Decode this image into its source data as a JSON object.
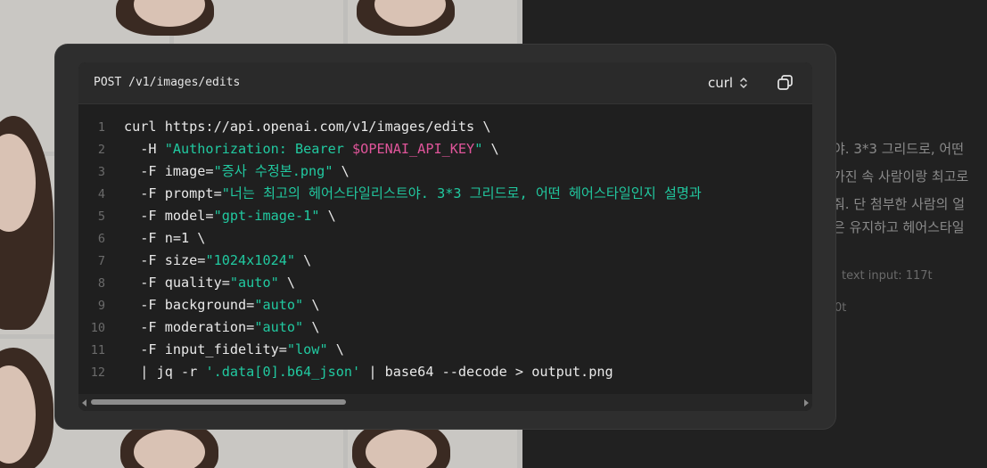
{
  "modal": {
    "endpoint": "POST /v1/images/edits",
    "language": "curl",
    "copy_icon": "copy-icon",
    "chevron_icon": "chevron-up-down-icon"
  },
  "code_lines": [
    {
      "num": "1",
      "parts": [
        {
          "t": "curl https://api.openai.com/v1/images/edits \\",
          "c": ""
        }
      ]
    },
    {
      "num": "2",
      "parts": [
        {
          "t": "  -H ",
          "c": ""
        },
        {
          "t": "\"Authorization: Bearer ",
          "c": "str"
        },
        {
          "t": "$OPENAI_API_KEY",
          "c": "var"
        },
        {
          "t": "\"",
          "c": "str"
        },
        {
          "t": " \\",
          "c": ""
        }
      ]
    },
    {
      "num": "3",
      "parts": [
        {
          "t": "  -F image=",
          "c": ""
        },
        {
          "t": "\"증사 수정본.png\"",
          "c": "str"
        },
        {
          "t": " \\",
          "c": ""
        }
      ]
    },
    {
      "num": "4",
      "parts": [
        {
          "t": "  -F prompt=",
          "c": ""
        },
        {
          "t": "\"너는 최고의 헤어스타일리스트야. 3*3 그리드로, 어떤 헤어스타일인지 설명과",
          "c": "str"
        }
      ]
    },
    {
      "num": "5",
      "parts": [
        {
          "t": "  -F model=",
          "c": ""
        },
        {
          "t": "\"gpt-image-1\"",
          "c": "str"
        },
        {
          "t": " \\",
          "c": ""
        }
      ]
    },
    {
      "num": "6",
      "parts": [
        {
          "t": "  -F n=1 \\",
          "c": ""
        }
      ]
    },
    {
      "num": "7",
      "parts": [
        {
          "t": "  -F size=",
          "c": ""
        },
        {
          "t": "\"1024x1024\"",
          "c": "str"
        },
        {
          "t": " \\",
          "c": ""
        }
      ]
    },
    {
      "num": "8",
      "parts": [
        {
          "t": "  -F quality=",
          "c": ""
        },
        {
          "t": "\"auto\"",
          "c": "str"
        },
        {
          "t": " \\",
          "c": ""
        }
      ]
    },
    {
      "num": "9",
      "parts": [
        {
          "t": "  -F background=",
          "c": ""
        },
        {
          "t": "\"auto\"",
          "c": "str"
        },
        {
          "t": " \\",
          "c": ""
        }
      ]
    },
    {
      "num": "10",
      "parts": [
        {
          "t": "  -F moderation=",
          "c": ""
        },
        {
          "t": "\"auto\"",
          "c": "str"
        },
        {
          "t": " \\",
          "c": ""
        }
      ]
    },
    {
      "num": "11",
      "parts": [
        {
          "t": "  -F input_fidelity=",
          "c": ""
        },
        {
          "t": "\"low\"",
          "c": "str"
        },
        {
          "t": " \\",
          "c": ""
        }
      ]
    },
    {
      "num": "12",
      "parts": [
        {
          "t": "  | jq -r ",
          "c": ""
        },
        {
          "t": "'.data[0].b64_json'",
          "c": "str"
        },
        {
          "t": " | base64 --decode > output.png",
          "c": ""
        }
      ]
    }
  ],
  "background": {
    "text_lines": [
      "야. 3*3 그리드로, 어떤",
      "가진 속 사람이랑 최고로",
      "줘. 단 첨부한 사람의 얼",
      "은 유지하고 헤어스타일"
    ],
    "meta_1": "text input: 117t",
    "meta_2": "0t"
  }
}
